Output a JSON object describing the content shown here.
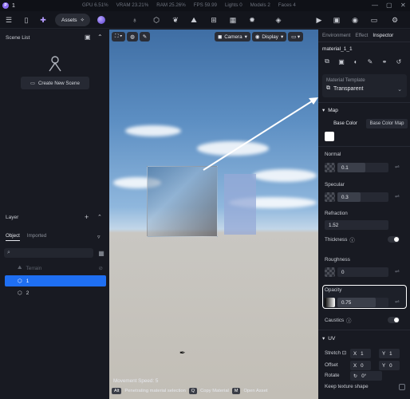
{
  "window": {
    "number": "1"
  },
  "stats": {
    "gpu": "GPU 6.51%",
    "vram": "VRAM 23.21%",
    "ram": "RAM 25.26%",
    "fps": "FPS 59.99",
    "lights": "Lights 0",
    "models": "Models 2",
    "faces": "Faces 4"
  },
  "toolbar": {
    "assets_label": "Assets"
  },
  "left": {
    "scene_list_title": "Scene List",
    "new_scene_label": "Create New Scene",
    "layer_title": "Layer",
    "tabs": [
      "Object",
      "Imported"
    ],
    "tree": [
      {
        "label": "Terrain",
        "state": "dim"
      },
      {
        "label": "1",
        "state": "selected"
      },
      {
        "label": "2",
        "state": "normal"
      }
    ]
  },
  "viewport": {
    "camera_label": "Camera",
    "display_label": "Display",
    "movement_speed": "Movement Speed: 5",
    "hints": [
      {
        "key": "Alt",
        "text": "Penetrating material selection"
      },
      {
        "key": "Q",
        "text": "Copy Material"
      },
      {
        "key": "M",
        "text": "Open Asset"
      }
    ]
  },
  "right": {
    "tabs": [
      "Environment",
      "Effect",
      "Inspector"
    ],
    "material_name": "material_1_1",
    "template_label": "Material Template",
    "template_value": "Transparent",
    "map_section": "Map",
    "base_color_tabs": [
      "Base Color",
      "Base Color Map"
    ],
    "normal": {
      "label": "Normal",
      "value": "0.1",
      "fraction": 0.55
    },
    "specular": {
      "label": "Specular",
      "value": "0.3",
      "fraction": 0.45
    },
    "refraction": {
      "label": "Refraction",
      "value": "1.52"
    },
    "thickness_label": "Thickness",
    "roughness": {
      "label": "Roughness",
      "value": "0"
    },
    "opacity": {
      "label": "Opacity",
      "value": "0.75",
      "fraction": 0.75
    },
    "caustics_label": "Caustics",
    "uv_section": "UV",
    "stretch_label": "Stretch",
    "stretch_x": "1",
    "stretch_y": "1",
    "offset_label": "Offset",
    "offset_x": "0",
    "offset_y": "0",
    "rotate_label": "Rotate",
    "rotate_value": "0°",
    "keep_texture_label": "Keep texture shape"
  },
  "colors": {
    "accent": "#1f6ff2",
    "highlight": "#ffffff"
  }
}
